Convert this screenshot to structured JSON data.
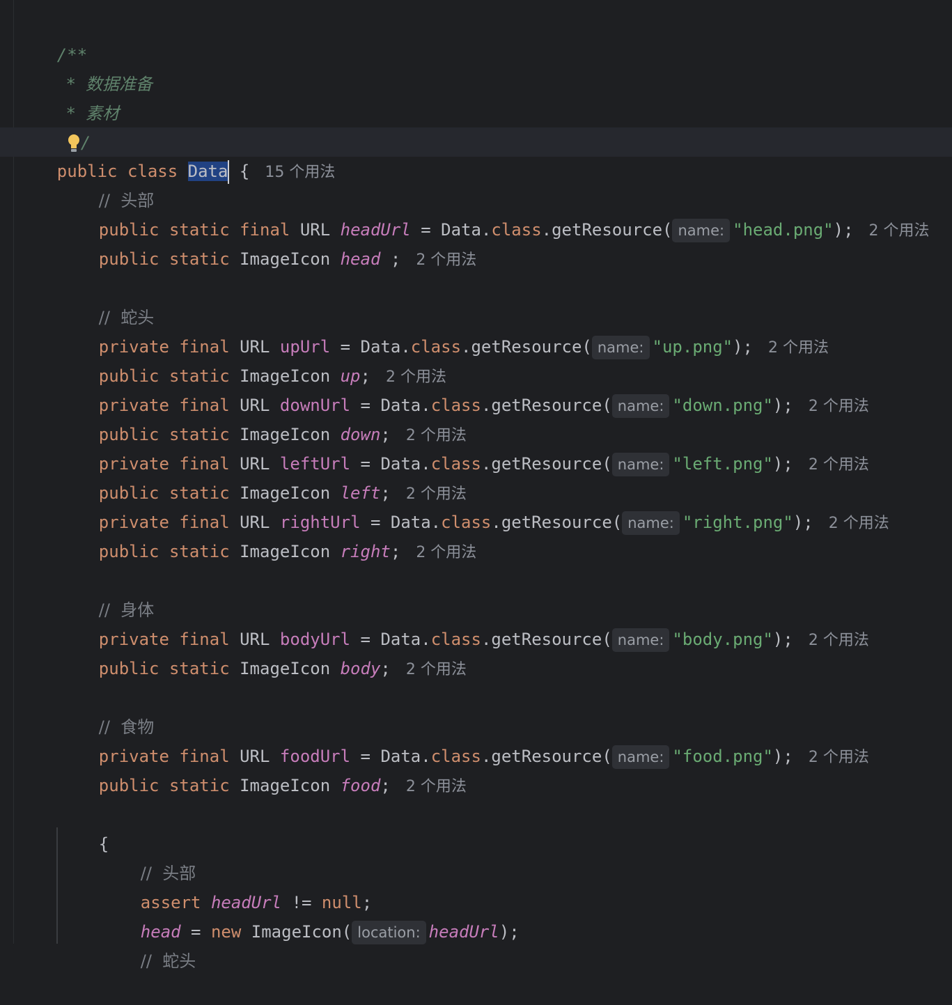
{
  "usages_15": "15 个用法",
  "usages_2": "2 个用法",
  "hints": {
    "name": "name:",
    "location": "location:"
  },
  "doc": {
    "open": "/**",
    "line1": "*  数据准备",
    "line2": "*  素材",
    "close": "/"
  },
  "class_decl": {
    "kw1": "public",
    "kw2": "class",
    "name": "Data",
    "brace": "{"
  },
  "comments": {
    "head": "//  头部",
    "snake_head": "//  蛇头",
    "body": "//  身体",
    "food": "//  食物"
  },
  "tokens": {
    "public": "public",
    "private": "private",
    "static": "static",
    "final": "final",
    "URL": "URL",
    "ImageIcon": "ImageIcon",
    "Data": "Data",
    "dot": ".",
    "class": "class",
    "getResource": "getResource(",
    "eq": "=",
    "semi": ";",
    "close_semi": ");",
    "space_semi": " ;",
    "assert": "assert",
    "neq": "!=",
    "null": "null",
    "new": "new",
    "ImageIcon_call": "ImageIcon(",
    "open_brace": "{"
  },
  "fields": {
    "headUrl": "headUrl",
    "head": "head",
    "upUrl": "upUrl",
    "up": "up",
    "downUrl": "downUrl",
    "down": "down",
    "leftUrl": "leftUrl",
    "left": "left",
    "rightUrl": "rightUrl",
    "right": "right",
    "bodyUrl": "bodyUrl",
    "body": "body",
    "foodUrl": "foodUrl",
    "food": "food"
  },
  "strings": {
    "head": "\"head.png\"",
    "up": "\"up.png\"",
    "down": "\"down.png\"",
    "left": "\"left.png\"",
    "right": "\"right.png\"",
    "body": "\"body.png\"",
    "food": "\"food.png\""
  }
}
